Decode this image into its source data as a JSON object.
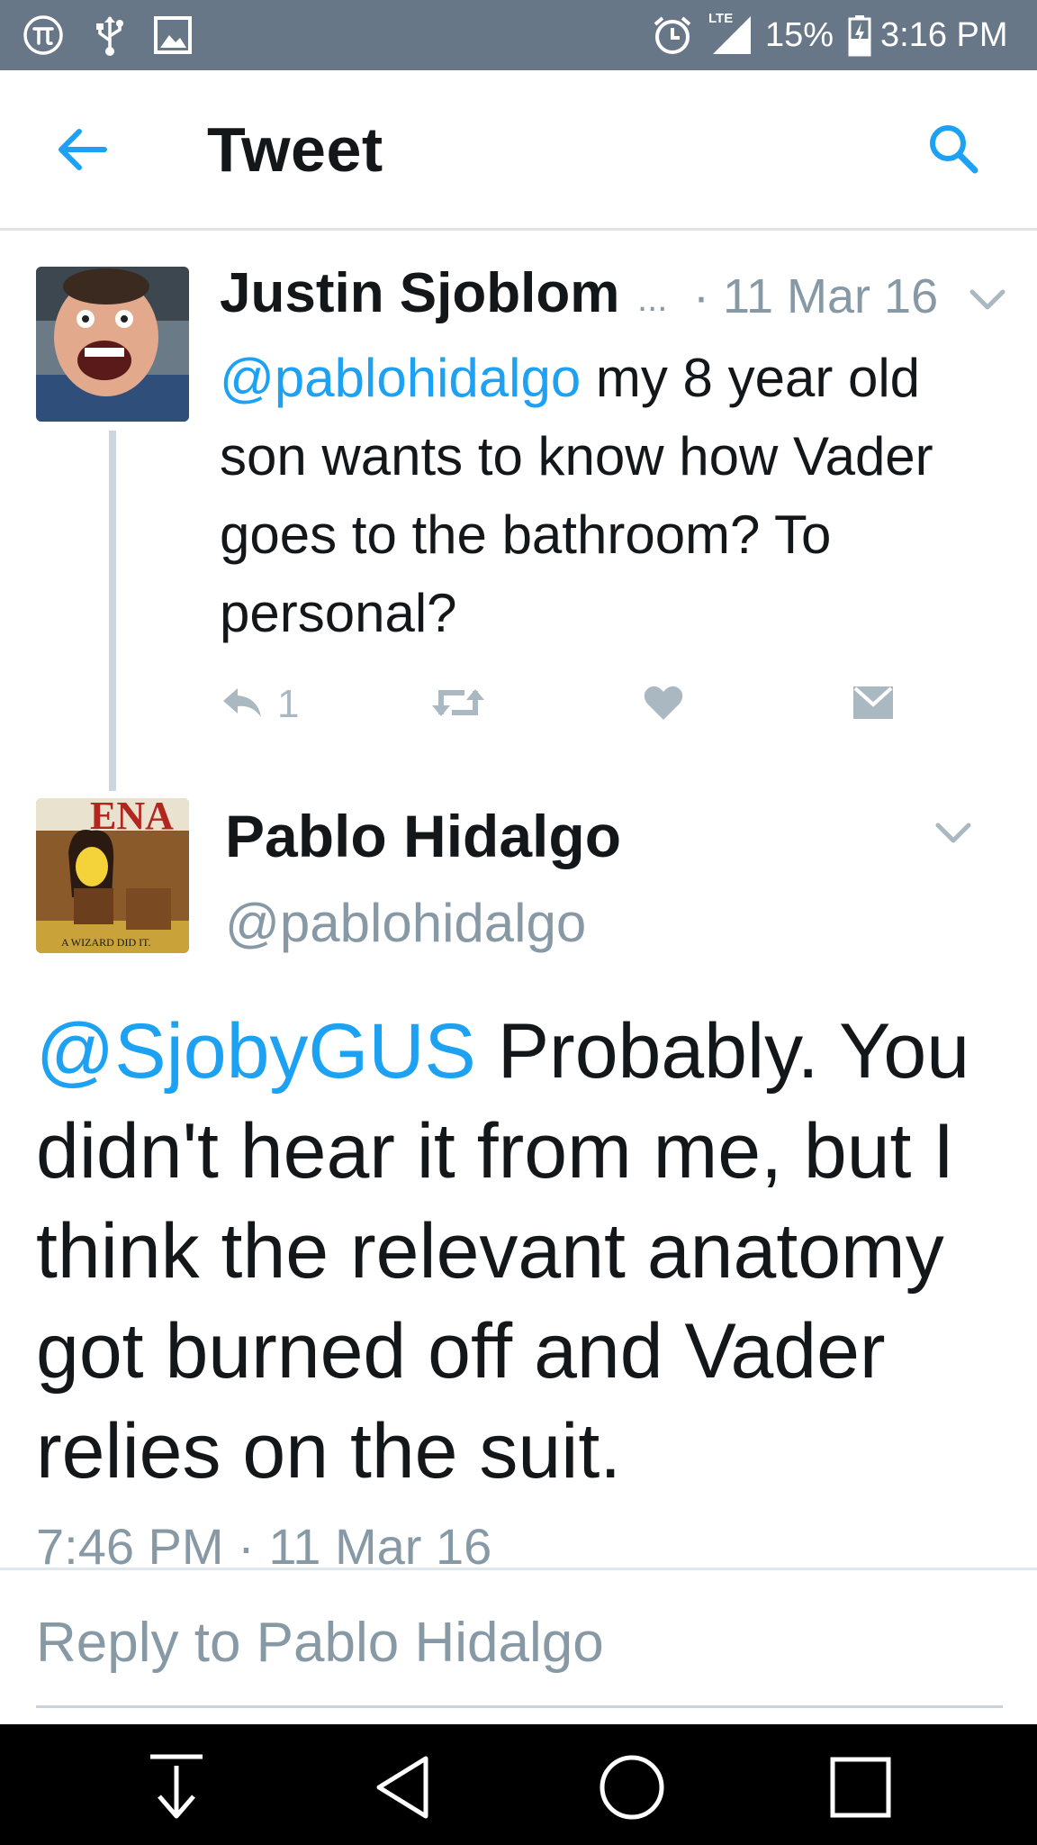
{
  "status_bar": {
    "icons_left": [
      "pi-icon",
      "usb-icon",
      "image-icon"
    ],
    "network": "LTE",
    "battery": "15%",
    "time": "3:16 PM"
  },
  "header": {
    "title": "Tweet"
  },
  "tweets": [
    {
      "name": "Justin Sjoblom",
      "truncation": "...",
      "meta": "· 11 Mar 16",
      "mention": "@pablohidalgo",
      "text": " my 8 year old son wants to know how Vader goes to the bathroom? To personal?",
      "reply_count": "1"
    },
    {
      "name": "Pablo Hidalgo",
      "handle": "@pablohidalgo",
      "avatar_caption": "A WIZARD DID IT.",
      "avatar_banner": "ENA",
      "mention": "@SjobyGUS",
      "text": " Probably. You didn't hear it from me, but I think the relevant anatomy got burned off and Vader relies on the suit.",
      "timestamp": "7:46 PM · 11 Mar 16"
    }
  ],
  "reply_box": {
    "placeholder": "Reply to Pablo Hidalgo"
  },
  "colors": {
    "status_bar": "#687788",
    "link": "#1da1f2",
    "muted": "#8899a6",
    "text": "#14171a",
    "nav_bar": "#000000"
  }
}
